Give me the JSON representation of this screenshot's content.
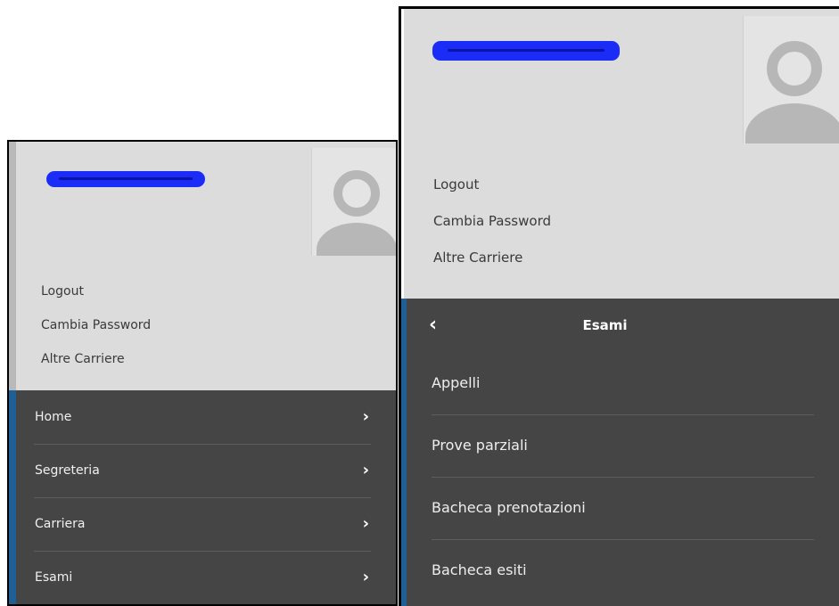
{
  "left_panel": {
    "user_links": [
      "Logout",
      "Cambia Password",
      "Altre Carriere"
    ],
    "menu_items": [
      {
        "label": "Home",
        "icon": "chevron-right-icon"
      },
      {
        "label": "Segreteria",
        "icon": "chevron-right-icon"
      },
      {
        "label": "Carriera",
        "icon": "chevron-right-icon"
      },
      {
        "label": "Esami",
        "icon": "chevron-right-icon"
      }
    ]
  },
  "right_panel": {
    "user_links": [
      "Logout",
      "Cambia Password",
      "Altre Carriere"
    ],
    "submenu_title": "Esami",
    "submenu_items": [
      "Appelli",
      "Prove parziali",
      "Bacheca prenotazioni",
      "Bacheca esiti"
    ]
  },
  "icons": {
    "chevron": "›",
    "back": "‹"
  },
  "colors": {
    "header_bg": "#dcdcdc",
    "menu_bg": "#454545",
    "accent": "#1f5f94",
    "redaction": "#1a2cf5"
  }
}
